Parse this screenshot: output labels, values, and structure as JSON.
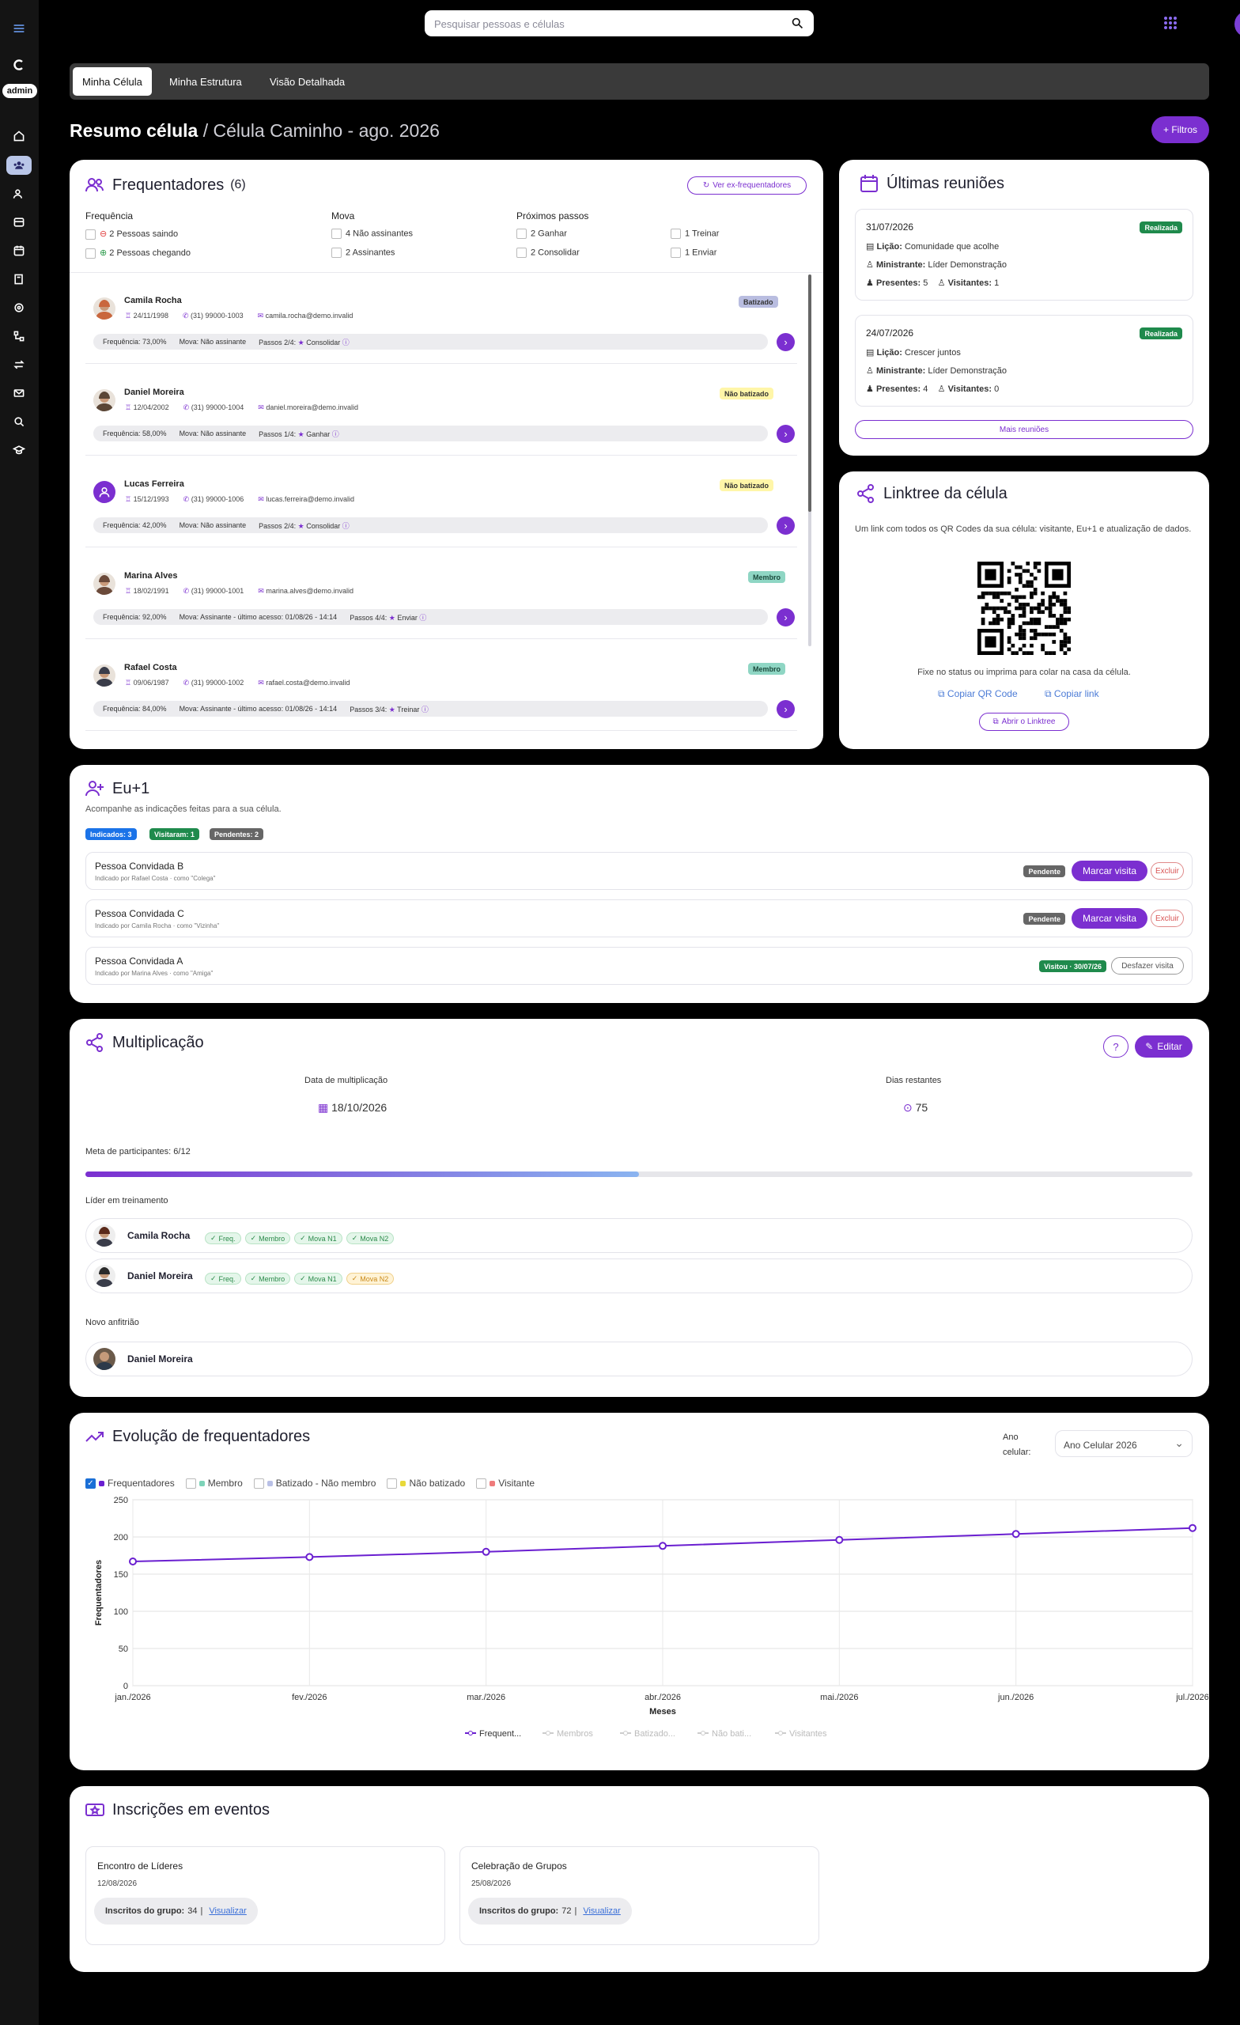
{
  "sidebar": {
    "admin_label": "admin"
  },
  "search": {
    "placeholder": "Pesquisar pessoas e células"
  },
  "tabs": [
    "Minha Célula",
    "Minha Estrutura",
    "Visão Detalhada"
  ],
  "title": {
    "bold": "Resumo célula",
    "rest": " / Célula Caminho - ago. 2026"
  },
  "filters_button": "+ Filtros",
  "frequentadores": {
    "title": "Frequentadores",
    "count": "(6)",
    "ex_button": "Ver ex-frequentadores",
    "groups": {
      "freq_title": "Frequência",
      "freq_items": [
        "2 Pessoas saindo",
        "2 Pessoas chegando"
      ],
      "mova_title": "Mova",
      "mova_items": [
        "4 Não assinantes",
        "2 Assinantes"
      ],
      "steps_title": "Próximos passos",
      "steps_left": [
        "2 Ganhar",
        "2 Consolidar"
      ],
      "steps_right": [
        "1 Treinar",
        "1 Enviar"
      ]
    },
    "people": [
      {
        "name": "Camila Rocha",
        "birth": "24/11/1998",
        "phone": "(31) 99000-1003",
        "email": "camila.rocha@demo.invalid",
        "badge": "Batizado",
        "freq": "Frequência: 73,00%",
        "mova": "Mova: Não assinante",
        "steps": "Passos 2/4:",
        "step": "Consolidar"
      },
      {
        "name": "Daniel Moreira",
        "birth": "12/04/2002",
        "phone": "(31) 99000-1004",
        "email": "daniel.moreira@demo.invalid",
        "badge": "Não batizado",
        "freq": "Frequência: 58,00%",
        "mova": "Mova: Não assinante",
        "steps": "Passos 1/4:",
        "step": "Ganhar"
      },
      {
        "name": "Lucas Ferreira",
        "birth": "15/12/1993",
        "phone": "(31) 99000-1006",
        "email": "lucas.ferreira@demo.invalid",
        "badge": "Não batizado",
        "freq": "Frequência: 42,00%",
        "mova": "Mova: Não assinante",
        "steps": "Passos 2/4:",
        "step": "Consolidar"
      },
      {
        "name": "Marina Alves",
        "birth": "18/02/1991",
        "phone": "(31) 99000-1001",
        "email": "marina.alves@demo.invalid",
        "badge": "Membro",
        "freq": "Frequência: 92,00%",
        "mova": "Mova: Assinante - último acesso: 01/08/26 - 14:14",
        "steps": "Passos 4/4:",
        "step": "Enviar"
      },
      {
        "name": "Rafael Costa",
        "birth": "09/06/1987",
        "phone": "(31) 99000-1002",
        "email": "rafael.costa@demo.invalid",
        "badge": "Membro",
        "freq": "Frequência: 84,00%",
        "mova": "Mova: Assinante - último acesso: 01/08/26 - 14:14",
        "steps": "Passos 3/4:",
        "step": "Treinar"
      }
    ]
  },
  "reunioes": {
    "title": "Últimas reuniões",
    "items": [
      {
        "date": "31/07/2026",
        "status": "Realizada",
        "licao_label": "Lição:",
        "licao": "Comunidade que acolhe",
        "min_label": "Ministrante:",
        "ministrante": "Líder Demonstração",
        "pres_label": "Presentes:",
        "presentes": "5",
        "vis_label": "Visitantes:",
        "visitantes": "1"
      },
      {
        "date": "24/07/2026",
        "status": "Realizada",
        "licao_label": "Lição:",
        "licao": "Crescer juntos",
        "min_label": "Ministrante:",
        "ministrante": "Líder Demonstração",
        "pres_label": "Presentes:",
        "presentes": "4",
        "vis_label": "Visitantes:",
        "visitantes": "0"
      }
    ],
    "more_button": "Mais reuniões"
  },
  "linktree": {
    "title": "Linktree da célula",
    "desc": "Um link com todos os QR Codes da sua célula: visitante, Eu+1 e atualização de dados.",
    "hint": "Fixe no status ou imprima para colar na casa da célula.",
    "copy_qr": "Copiar QR Code",
    "copy_link": "Copiar link",
    "open": "Abrir o Linktree"
  },
  "eu1": {
    "title": "Eu+1",
    "subtitle": "Acompanhe as indicações feitas para a sua célula.",
    "chips": [
      "Indicados: 3",
      "Visitaram: 1",
      "Pendentes: 2"
    ],
    "rows": [
      {
        "name": "Pessoa Convidada B",
        "meta": "Indicado por Rafael Costa · como \"Colega\"",
        "status": "Pendente",
        "action": "Marcar visita",
        "secondary": "Excluir"
      },
      {
        "name": "Pessoa Convidada C",
        "meta": "Indicado por Camila Rocha · como \"Vizinha\"",
        "status": "Pendente",
        "action": "Marcar visita",
        "secondary": "Excluir"
      },
      {
        "name": "Pessoa Convidada A",
        "meta": "Indicado por Marina Alves · como \"Amiga\"",
        "status": "Visitou · 30/07/26",
        "secondary": "Desfazer visita"
      }
    ]
  },
  "multi": {
    "title": "Multiplicação",
    "edit": "Editar",
    "date_label": "Data de multiplicação",
    "date": "18/10/2026",
    "days_label": "Dias restantes",
    "days": "75",
    "meta_label": "Meta de participantes: 6/12",
    "progress": 0.5,
    "leader_label": "Líder em treinamento",
    "leaders": [
      {
        "name": "Camila Rocha",
        "tags": [
          "Freq.",
          "Membro",
          "Mova N1",
          "Mova N2"
        ]
      },
      {
        "name": "Daniel Moreira",
        "tags": [
          "Freq.",
          "Membro",
          "Mova N1",
          "Mova N2"
        ]
      }
    ],
    "host_label": "Novo anfitrião",
    "host": "Daniel Moreira"
  },
  "evolucao": {
    "title": "Evolução de frequentadores",
    "year_label": "Ano celular:",
    "year_value": "Ano Celular 2026",
    "filters": [
      "Frequentadores",
      "Membro",
      "Batizado - Não membro",
      "Não batizado",
      "Visitante"
    ],
    "bottom_legend": [
      "Frequent...",
      "Membros",
      "Batizado...",
      "Não bati...",
      "Visitantes"
    ]
  },
  "chart_data": {
    "type": "line",
    "categories": [
      "jan./2026",
      "fev./2026",
      "mar./2026",
      "abr./2026",
      "mai./2026",
      "jun./2026",
      "jul./2026"
    ],
    "series": [
      {
        "name": "Frequentadores",
        "values": [
          167,
          173,
          180,
          188,
          196,
          204,
          212
        ]
      }
    ],
    "xlabel": "Meses",
    "ylabel": "Frequentadores",
    "ylim": [
      0,
      250
    ],
    "yticks": [
      "0",
      "50",
      "100",
      "150",
      "200",
      "250"
    ],
    "grid": true,
    "colors": {
      "Frequentadores": "#6a1fd0",
      "Membro": "#7dd3b8",
      "Batizado - Não membro": "#b9c0e6",
      "Não batizado": "#e8d93a",
      "Visitante": "#ef7b7b"
    }
  },
  "eventos": {
    "title": "Inscrições em eventos",
    "items": [
      {
        "name": "Encontro de Líderes",
        "date": "12/08/2026",
        "label": "Inscritos do grupo:",
        "count": "34",
        "link": "Visualizar"
      },
      {
        "name": "Celebração de Grupos",
        "date": "25/08/2026",
        "label": "Inscritos do grupo:",
        "count": "72",
        "link": "Visualizar"
      }
    ]
  }
}
